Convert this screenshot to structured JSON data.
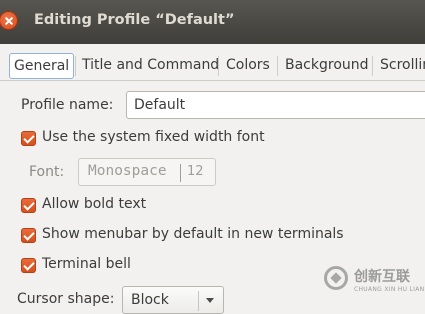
{
  "window": {
    "title": "Editing Profile “Default”",
    "close_icon": "close-icon"
  },
  "tabs": [
    {
      "label": "General",
      "active": true
    },
    {
      "label": "Title and Command",
      "active": false
    },
    {
      "label": "Colors",
      "active": false
    },
    {
      "label": "Background",
      "active": false
    },
    {
      "label": "Scrolling",
      "active": false
    }
  ],
  "general": {
    "profile_name_label": "Profile name:",
    "profile_name_value": "Default",
    "system_font_label": "Use the system fixed width font",
    "system_font_checked": true,
    "font_label": "Font:",
    "font_name": "Monospace",
    "font_size": "12",
    "bold_label": "Allow bold text",
    "bold_checked": true,
    "menubar_label": "Show menubar by default in new terminals",
    "menubar_checked": true,
    "bell_label": "Terminal bell",
    "bell_checked": true,
    "cursor_label": "Cursor shape:",
    "cursor_value": "Block"
  },
  "watermark": {
    "text": "创新互联",
    "subtext": "CHUANG XIN HU LIAN"
  },
  "colors": {
    "accent": "#e0571f",
    "titlebar": "#3f3e3a",
    "background": "#f2f1f0"
  }
}
